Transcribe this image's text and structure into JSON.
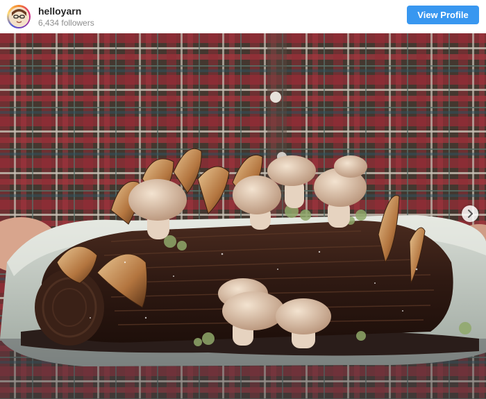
{
  "header": {
    "username": "helloyarn",
    "followers": "6,434 followers",
    "view_profile_label": "View Profile",
    "accent_color": "#3897f0"
  },
  "post": {
    "image_subject": "chocolate yule log with meringue mushrooms",
    "next_icon": "chevron-right-icon"
  }
}
